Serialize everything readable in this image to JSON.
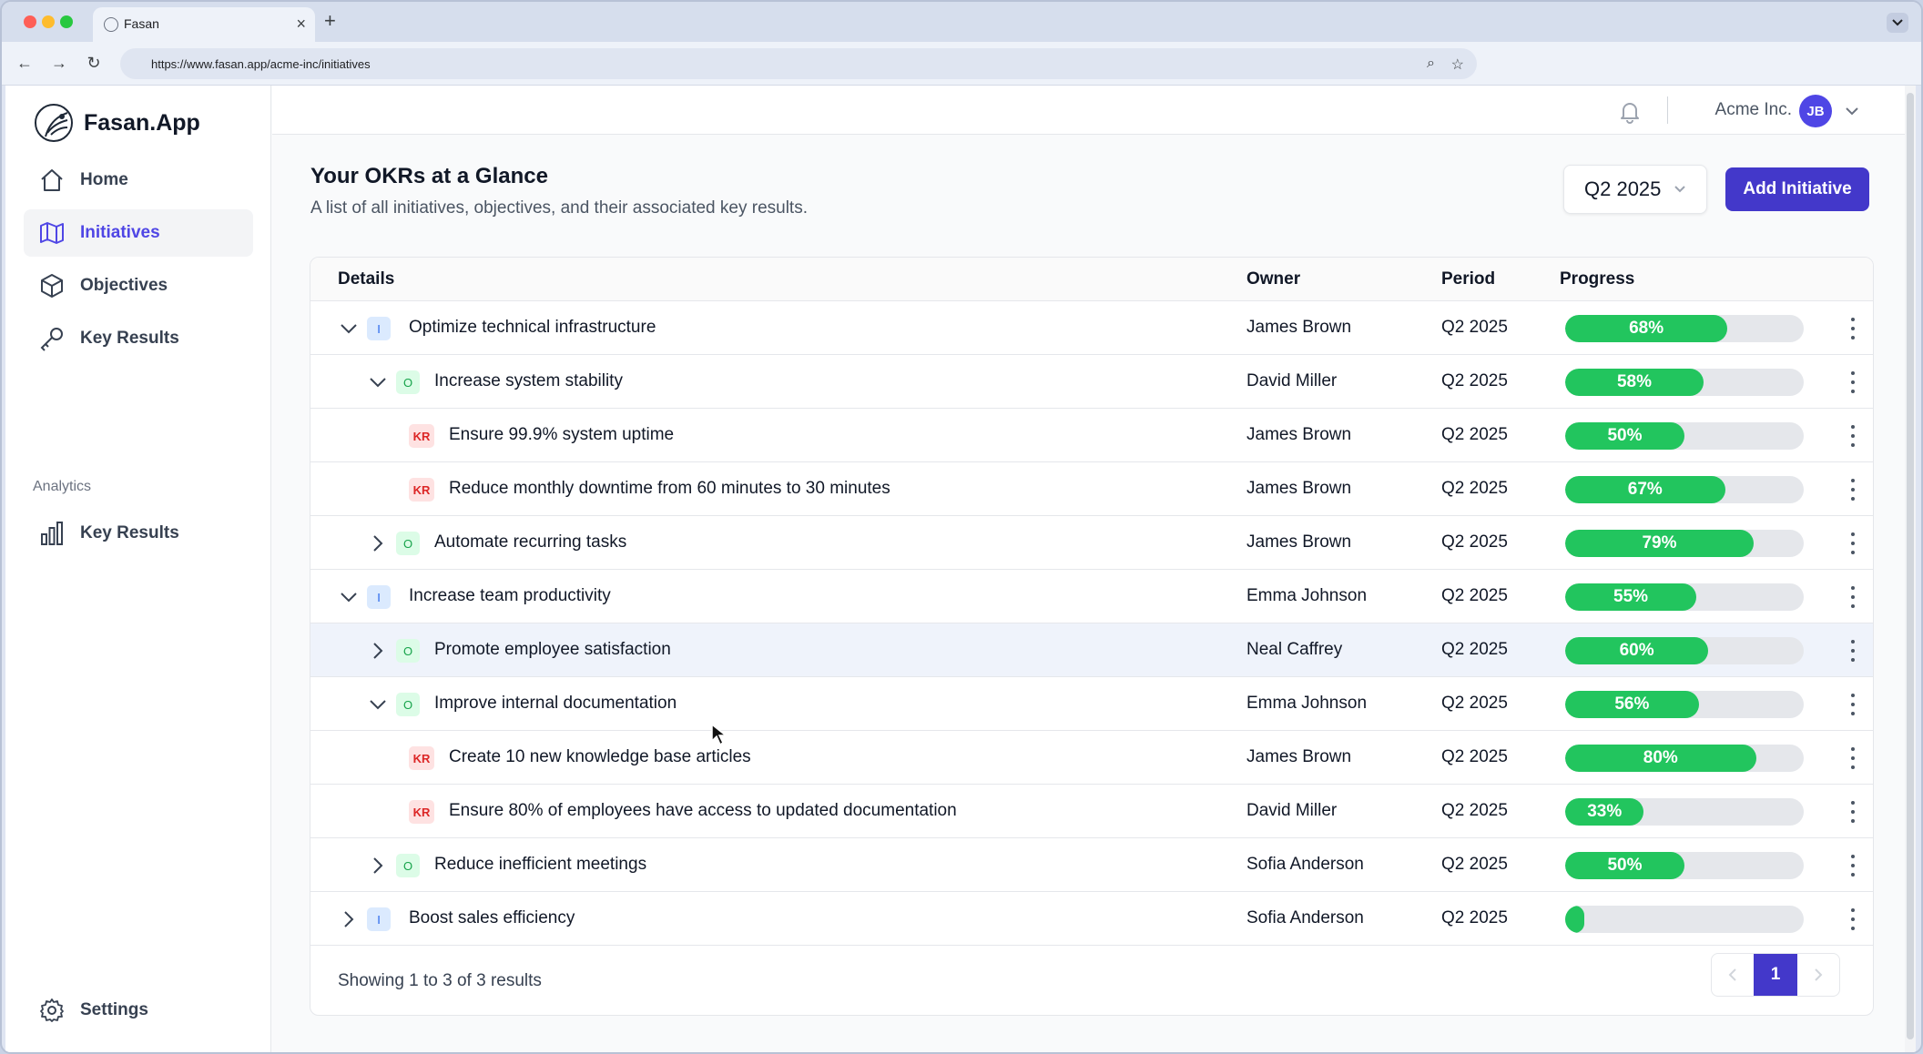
{
  "browser": {
    "tab_title": "Fasan",
    "url": "https://www.fasan.app/acme-inc/initiatives"
  },
  "sidebar": {
    "logo_text": "Fasan.App",
    "items": [
      {
        "label": "Home",
        "icon": "home-icon"
      },
      {
        "label": "Initiatives",
        "icon": "map-icon",
        "active": true
      },
      {
        "label": "Objectives",
        "icon": "cube-icon"
      },
      {
        "label": "Key Results",
        "icon": "key-icon"
      }
    ],
    "analytics_label": "Analytics",
    "analytics_items": [
      {
        "label": "Key Results",
        "icon": "bar-chart-icon"
      }
    ],
    "settings_label": "Settings"
  },
  "topbar": {
    "org_name": "Acme Inc.",
    "avatar_initials": "JB"
  },
  "header": {
    "title": "Your OKRs at a Glance",
    "subtitle": "A list of all initiatives, objectives, and their associated key results.",
    "period_select": "Q2 2025",
    "add_button": "Add Initiative"
  },
  "colors": {
    "accent": "#4338ca",
    "progress": "#22c55e",
    "progress_track": "#e5e7eb"
  },
  "table": {
    "headers": {
      "details": "Details",
      "owner": "Owner",
      "period": "Period",
      "progress": "Progress"
    },
    "rows": [
      {
        "type": "I",
        "expand": "expanded",
        "title": "Optimize technical infrastructure",
        "owner": "James Brown",
        "period": "Q2 2025",
        "progress": 68,
        "progress_label": "68%"
      },
      {
        "type": "O",
        "expand": "expanded",
        "title": "Increase system stability",
        "owner": "David Miller",
        "period": "Q2 2025",
        "progress": 58,
        "progress_label": "58%"
      },
      {
        "type": "KR",
        "expand": "none",
        "title": "Ensure 99.9% system uptime",
        "owner": "James Brown",
        "period": "Q2 2025",
        "progress": 50,
        "progress_label": "50%"
      },
      {
        "type": "KR",
        "expand": "none",
        "title": "Reduce monthly downtime from 60 minutes to 30 minutes",
        "owner": "James Brown",
        "period": "Q2 2025",
        "progress": 67,
        "progress_label": "67%"
      },
      {
        "type": "O",
        "expand": "collapsed",
        "title": "Automate recurring tasks",
        "owner": "James Brown",
        "period": "Q2 2025",
        "progress": 79,
        "progress_label": "79%"
      },
      {
        "type": "I",
        "expand": "expanded",
        "title": "Increase team productivity",
        "owner": "Emma Johnson",
        "period": "Q2 2025",
        "progress": 55,
        "progress_label": "55%"
      },
      {
        "type": "O",
        "expand": "collapsed",
        "title": "Promote employee satisfaction",
        "owner": "Neal Caffrey",
        "period": "Q2 2025",
        "progress": 60,
        "progress_label": "60%",
        "hover": true
      },
      {
        "type": "O",
        "expand": "expanded",
        "title": "Improve internal documentation",
        "owner": "Emma Johnson",
        "period": "Q2 2025",
        "progress": 56,
        "progress_label": "56%"
      },
      {
        "type": "KR",
        "expand": "none",
        "title": "Create 10 new knowledge base articles",
        "owner": "James Brown",
        "period": "Q2 2025",
        "progress": 80,
        "progress_label": "80%"
      },
      {
        "type": "KR",
        "expand": "none",
        "title": "Ensure 80% of employees have access to updated documentation",
        "owner": "David Miller",
        "period": "Q2 2025",
        "progress": 33,
        "progress_label": "33%"
      },
      {
        "type": "O",
        "expand": "collapsed",
        "title": "Reduce inefficient meetings",
        "owner": "Sofia Anderson",
        "period": "Q2 2025",
        "progress": 50,
        "progress_label": "50%"
      },
      {
        "type": "I",
        "expand": "collapsed",
        "title": "Boost sales efficiency",
        "owner": "Sofia Anderson",
        "period": "Q2 2025",
        "progress": 8,
        "progress_label": ""
      }
    ],
    "footer": "Showing 1 to 3 of 3 results",
    "current_page": "1"
  }
}
